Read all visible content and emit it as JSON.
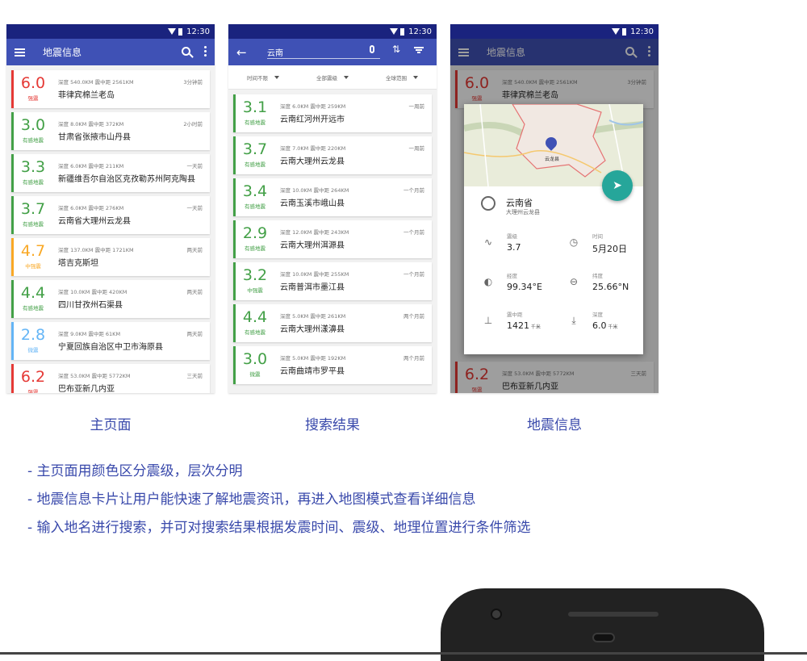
{
  "status_time": "12:30",
  "home": {
    "title": "地震信息",
    "items": [
      {
        "mag": "6.0",
        "level": "强震",
        "color": "#e53935",
        "depth": "深度 540.0KM",
        "dist": "震中距 2561KM",
        "place": "菲律宾棉兰老岛",
        "time": "3分钟前"
      },
      {
        "mag": "3.0",
        "level": "有感地震",
        "color": "#43a047",
        "depth": "深度 8.0KM",
        "dist": "震中距 372KM",
        "place": "甘肃省张掖市山丹县",
        "time": "2小时前"
      },
      {
        "mag": "3.3",
        "level": "有感地震",
        "color": "#43a047",
        "depth": "深度 6.0KM",
        "dist": "震中距 211KM",
        "place": "新疆维吾尔自治区克孜勒苏州阿克陶县",
        "time": "一天前"
      },
      {
        "mag": "3.7",
        "level": "有感地震",
        "color": "#43a047",
        "depth": "深度 6.0KM",
        "dist": "震中距 276KM",
        "place": "云南省大理州云龙县",
        "time": "一天前"
      },
      {
        "mag": "4.7",
        "level": "中强震",
        "color": "#f9a825",
        "depth": "深度 137.0KM",
        "dist": "震中距 1721KM",
        "place": "塔吉克斯坦",
        "time": "两天前"
      },
      {
        "mag": "4.4",
        "level": "有感地震",
        "color": "#43a047",
        "depth": "深度 10.0KM",
        "dist": "震中距 420KM",
        "place": "四川甘孜州石渠县",
        "time": "两天前"
      },
      {
        "mag": "2.8",
        "level": "微震",
        "color": "#64b5f6",
        "depth": "深度 9.0KM",
        "dist": "震中距 61KM",
        "place": "宁夏回族自治区中卫市海原县",
        "time": "两天前"
      },
      {
        "mag": "6.2",
        "level": "强震",
        "color": "#e53935",
        "depth": "深度 53.0KM",
        "dist": "震中距 5772KM",
        "place": "巴布亚新几内亚",
        "time": "三天前"
      }
    ]
  },
  "search": {
    "query": "云南",
    "filters": [
      "时间不限",
      "全部震级",
      "全球范围"
    ],
    "items": [
      {
        "mag": "3.1",
        "level": "有感地震",
        "color": "#43a047",
        "depth": "深度 6.0KM",
        "dist": "震中距 259KM",
        "place": "云南红河州开远市",
        "time": "一周前"
      },
      {
        "mag": "3.7",
        "level": "有感地震",
        "color": "#43a047",
        "depth": "深度 7.0KM",
        "dist": "震中距 220KM",
        "place": "云南大理州云龙县",
        "time": "一周前"
      },
      {
        "mag": "3.4",
        "level": "有感地震",
        "color": "#43a047",
        "depth": "深度 10.0KM",
        "dist": "震中距 264KM",
        "place": "云南玉溪市峨山县",
        "time": "一个月前"
      },
      {
        "mag": "2.9",
        "level": "有感地震",
        "color": "#43a047",
        "depth": "深度 12.0KM",
        "dist": "震中距 243KM",
        "place": "云南大理州洱源县",
        "time": "一个月前"
      },
      {
        "mag": "3.2",
        "level": "中强震",
        "color": "#43a047",
        "depth": "深度 10.0KM",
        "dist": "震中距 255KM",
        "place": "云南普洱市墨江县",
        "time": "一个月前"
      },
      {
        "mag": "4.4",
        "level": "有感地震",
        "color": "#43a047",
        "depth": "深度 5.0KM",
        "dist": "震中距 261KM",
        "place": "云南大理州漾濞县",
        "time": "两个月前"
      },
      {
        "mag": "3.0",
        "level": "微震",
        "color": "#43a047",
        "depth": "深度 5.0KM",
        "dist": "震中距 192KM",
        "place": "云南曲靖市罗平县",
        "time": "两个月前"
      }
    ]
  },
  "detail": {
    "title": "地震信息",
    "bg_top": {
      "mag": "6.0",
      "level": "强震",
      "color": "#e53935",
      "depth": "深度 540.0KM",
      "dist": "震中距 2561KM",
      "place": "菲律宾棉兰老岛",
      "time": "3分钟前"
    },
    "bg_bottom": {
      "mag": "6.2",
      "level": "强震",
      "color": "#e53935",
      "depth": "深度 53.0KM",
      "dist": "震中距 5772KM",
      "place": "巴布亚新几内亚",
      "time": "三天前"
    },
    "map_label": "云龙县",
    "province": "云南省",
    "county": "大理州云龙县",
    "stats": [
      {
        "label": "震级",
        "value": "3.7",
        "unit": "",
        "icon": "seismic-icon",
        "glyph": "∿"
      },
      {
        "label": "时间",
        "value": "5月20日",
        "unit": "",
        "icon": "timer-icon",
        "glyph": "◷"
      },
      {
        "label": "经度",
        "value": "99.34°E",
        "unit": "",
        "icon": "longitude-icon",
        "glyph": "◐"
      },
      {
        "label": "纬度",
        "value": "25.66°N",
        "unit": "",
        "icon": "latitude-icon",
        "glyph": "⊖"
      },
      {
        "label": "震中距",
        "value": "1421",
        "unit": "千米",
        "icon": "distance-icon",
        "glyph": "⊥"
      },
      {
        "label": "深度",
        "value": "6.0",
        "unit": "千米",
        "icon": "depth-icon",
        "glyph": "⤓"
      }
    ]
  },
  "captions": [
    "主页面",
    "搜索结果",
    "地震信息"
  ],
  "bullets": [
    "- 主页面用颜色区分震级，层次分明",
    "- 地震信息卡片让用户能快速了解地震资讯，再进入地图模式查看详细信息",
    "- 输入地名进行搜索，并可对搜索结果根据发震时间、震级、地理位置进行条件筛选"
  ]
}
